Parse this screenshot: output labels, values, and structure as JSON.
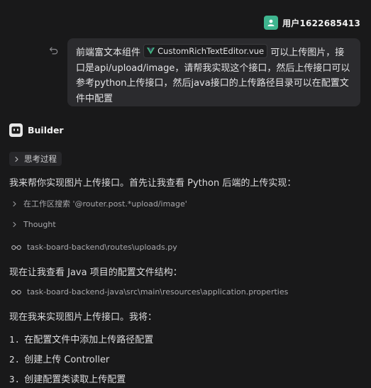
{
  "user": {
    "name": "用户1622685413"
  },
  "message": {
    "before_chip": "前端富文本组件",
    "chip_label": "CustomRichTextEditor.vue",
    "after_chip": "可以上传图片，接口是api/upload/image，请帮我实现这个接口，然后上传接口可以参考python上传接口，然后java接口的上传路径目录可以在配置文件中配置"
  },
  "assistant": {
    "name": "Builder"
  },
  "thinking": {
    "label": "思考过程"
  },
  "lines": {
    "intro": "我来帮你实现图片上传接口。首先让我查看 Python 后端的上传实现：",
    "java_config": "现在让我查看 Java 项目的配置文件结构：",
    "implement": "现在我来实现图片上传接口。我将："
  },
  "tools": {
    "search": "在工作区搜索 '@router.post.*upload/image'",
    "thought": "Thought",
    "file_uploads": "task-board-backend\\routes\\uploads.py",
    "file_props": "task-board-backend-java\\src\\main\\resources\\application.properties"
  },
  "steps": [
    {
      "num": "1.",
      "text": "在配置文件中添加上传路径配置"
    },
    {
      "num": "2.",
      "text": "创建上传 Controller"
    },
    {
      "num": "3.",
      "text": "创建配置类读取上传配置"
    }
  ],
  "colors": {
    "avatar": "#3fb58f",
    "vue_green": "#41b883",
    "bubble": "#2b2b2e",
    "background": "#19191a"
  }
}
